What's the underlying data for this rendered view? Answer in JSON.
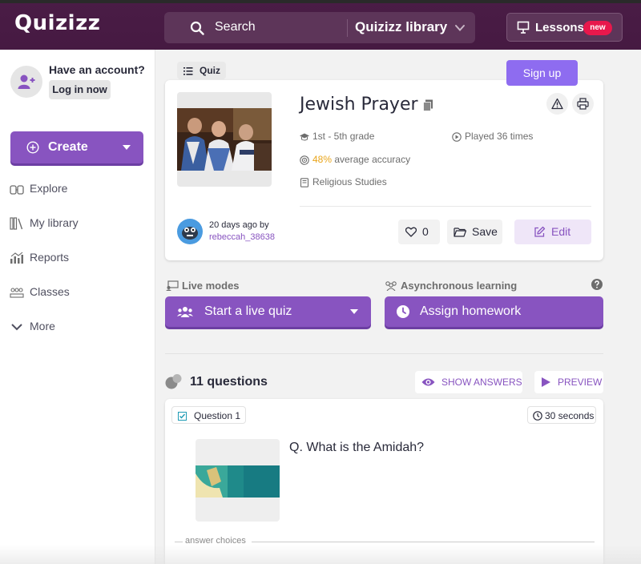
{
  "header": {
    "logo": "Quizizz",
    "search_placeholder": "Search",
    "library_select": "Quizizz library",
    "lessons_label": "Lessons",
    "new_badge": "new"
  },
  "sidebar": {
    "account_prompt": "Have an account?",
    "login_label": "Log in now",
    "create_label": "Create",
    "nav": [
      {
        "label": "Explore",
        "icon": "explore-icon"
      },
      {
        "label": "My library",
        "icon": "library-icon"
      },
      {
        "label": "Reports",
        "icon": "reports-icon"
      },
      {
        "label": "Classes",
        "icon": "classes-icon"
      },
      {
        "label": "More",
        "icon": "chevron-down-icon"
      }
    ]
  },
  "quiz": {
    "type_tag": "Quiz",
    "signup_label": "Sign up",
    "title": "Jewish Prayer",
    "grade": "1st - 5th grade",
    "played": "Played 36 times",
    "accuracy_value": "48%",
    "accuracy_text": " average accuracy",
    "subject": "Religious Studies",
    "author_when": "20 days ago by",
    "author_name": "rebeccah_38638",
    "likes": "0",
    "save_label": "Save",
    "edit_label": "Edit"
  },
  "modes": {
    "live_heading": "Live modes",
    "async_heading": "Asynchronous learning",
    "live_button": "Start a live quiz",
    "homework_button": "Assign homework"
  },
  "questions": {
    "count_label": "11 questions",
    "show_answers": "SHOW ANSWERS",
    "preview": "PREVIEW",
    "items": [
      {
        "number_label": "Question 1",
        "time_label": "30 seconds",
        "text": "Q. What is the Amidah?",
        "answers_heading": "answer choices"
      }
    ]
  },
  "colors": {
    "header_bg": "#461a42",
    "accent_purple": "#8854c0",
    "signup_purple": "#8e6cf0",
    "badge_red": "#e8184c",
    "accuracy_orange": "#e9a51a"
  }
}
